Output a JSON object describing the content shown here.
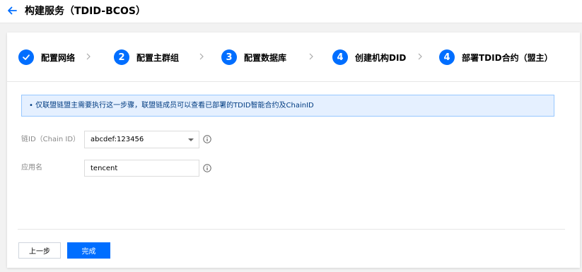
{
  "header": {
    "title": "构建服务（TDID-BCOS）",
    "back_icon": "arrow-left-icon",
    "accent": "#006eff"
  },
  "steps": [
    {
      "label": "配置网络",
      "status": "done",
      "icon": "check-icon"
    },
    {
      "number": "2",
      "label": "配置主群组",
      "status": "active"
    },
    {
      "number": "3",
      "label": "配置数据库",
      "status": "active"
    },
    {
      "number": "4",
      "label": "创建机构DID",
      "status": "active"
    },
    {
      "number": "4",
      "label": "部署TDID合约（盟主）",
      "status": "active"
    }
  ],
  "notice": {
    "text": "• 仅联盟链盟主需要执行这一步骤，联盟链成员可以查看已部署的TDID智能合约及ChainID"
  },
  "form": {
    "chain_id": {
      "label": "链ID（Chain ID）",
      "value": "abcdef:123456"
    },
    "app_name": {
      "label": "应用名",
      "value": "tencent"
    }
  },
  "footer": {
    "prev_label": "上一步",
    "done_label": "完成"
  }
}
